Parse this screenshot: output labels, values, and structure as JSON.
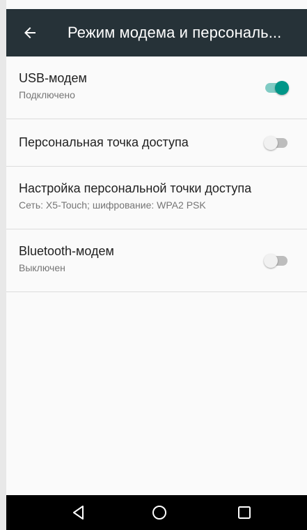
{
  "app_bar": {
    "title": "Режим модема и персональ..."
  },
  "settings": [
    {
      "title": "USB-модем",
      "summary": "Подключено",
      "toggle": true
    },
    {
      "title": "Персональная точка доступа",
      "toggle": false
    },
    {
      "title": "Настройка персональной точки доступа",
      "summary": "Сеть: X5-Touch; шифрование: WPA2 PSK"
    },
    {
      "title": "Bluetooth-модем",
      "summary": "Выключен",
      "toggle": false
    }
  ],
  "icons": {
    "back": "arrow-back-icon",
    "nav_back": "triangle-back-icon",
    "nav_home": "circle-home-icon",
    "nav_recents": "square-recents-icon"
  },
  "colors": {
    "toolbar": "#263238",
    "accent": "#009688",
    "accent_track": "#80cbc4",
    "navbar": "#000000"
  }
}
